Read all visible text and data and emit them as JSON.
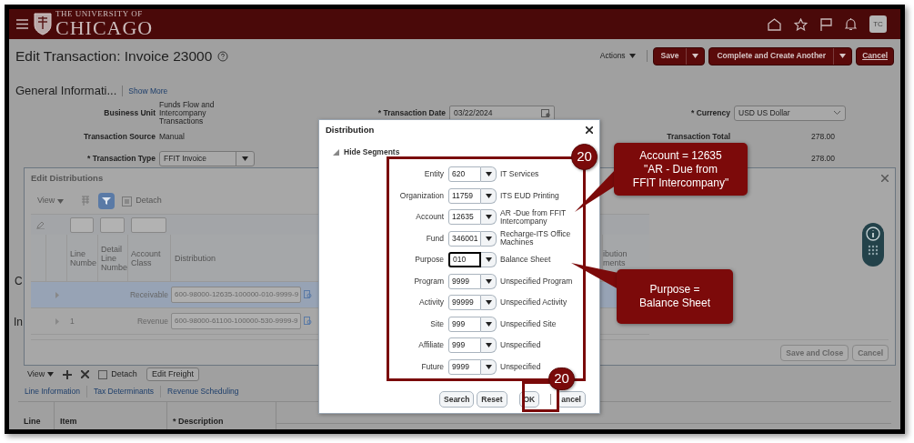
{
  "header": {
    "logo_top": "THE UNIVERSITY OF",
    "logo_bottom": "CHICAGO",
    "avatar": "TC"
  },
  "page": {
    "title": "Edit Transaction: Invoice 23000",
    "actions": "Actions",
    "buttons": [
      {
        "label": "Save",
        "kind": "split"
      },
      {
        "label": "Complete and Create Another",
        "kind": "split"
      },
      {
        "label": "Cancel",
        "kind": "plain"
      }
    ]
  },
  "general_information": {
    "title": "General Informati...",
    "show_more": "Show More",
    "columns": [
      [
        {
          "label": "Business Unit",
          "kind": "text",
          "value": "Funds Flow and Intercompany Transactions"
        },
        {
          "label": "Transaction Source",
          "kind": "text",
          "value": "Manual"
        },
        {
          "label": "* Transaction Type",
          "kind": "select",
          "value": "FFIT Invoice"
        }
      ],
      [
        {
          "label": "* Transaction Date",
          "kind": "date",
          "value": "03/22/2024"
        }
      ],
      [
        {
          "label": "* Currency",
          "kind": "select",
          "value": "USD US Dollar"
        },
        {
          "label": "Transaction Total",
          "kind": "text",
          "value": "278.00"
        },
        {
          "kind": "text",
          "value": "278.00"
        }
      ]
    ]
  },
  "covered_fragments": [
    "C",
    "In"
  ],
  "lines": {
    "toolbar": {
      "view": "View",
      "detach": "Detach",
      "edit_freight": "Edit Freight"
    },
    "tabs": [
      "Line Information",
      "Tax Determinants",
      "Revenue Scheduling"
    ],
    "columns": [
      "Line",
      "Item",
      "* Description"
    ]
  },
  "edit_distributions": {
    "title": "Edit Distributions",
    "toolbar": {
      "view": "View",
      "detach": "Detach"
    },
    "columns": [
      "Line Numbe",
      "Detail Line Numbe",
      "Account Class",
      "Distribution"
    ],
    "covered_column": "ibution ments",
    "rows": [
      {
        "account_class": "Receivable",
        "distribution": "600-98000-12635-100000-010-9999-9",
        "selected": true
      },
      {
        "line_number": "1",
        "account_class": "Revenue",
        "distribution": "600-98000-61100-100000-530-9999-9",
        "selected": false
      }
    ],
    "buttons": [
      "Save and Close",
      "Cancel"
    ]
  },
  "distribution": {
    "title": "Distribution",
    "segments_toggle": "Hide Segments",
    "segments": [
      {
        "label": "Entity",
        "value": "620",
        "description": "IT Services",
        "focused": false
      },
      {
        "label": "Organization",
        "value": "11759",
        "description": "ITS EUD Printing",
        "focused": false
      },
      {
        "label": "Account",
        "value": "12635",
        "description": "AR -Due from FFIT Intercompany",
        "focused": false
      },
      {
        "label": "Fund",
        "value": "346001",
        "description": "Recharge-ITS Office Machines",
        "focused": false
      },
      {
        "label": "Purpose",
        "value": "010",
        "description": "Balance Sheet",
        "focused": true
      },
      {
        "label": "Program",
        "value": "9999",
        "description": "Unspecified Program",
        "focused": false
      },
      {
        "label": "Activity",
        "value": "99999",
        "description": "Unspecified Activity",
        "focused": false
      },
      {
        "label": "Site",
        "value": "999",
        "description": "Unspecified Site",
        "focused": false
      },
      {
        "label": "Affiliate",
        "value": "999",
        "description": "Unspecified",
        "focused": false
      },
      {
        "label": "Future",
        "value": "9999",
        "description": "Unspecified",
        "focused": false
      }
    ],
    "buttons": [
      "Search",
      "Reset",
      "OK",
      "ancel"
    ]
  },
  "annotations": {
    "badges": [
      "20",
      "20"
    ],
    "callouts": [
      "Account = 12635\n\"AR - Due from\nFFIT Intercompany\"",
      "Purpose =\nBalance Sheet"
    ]
  }
}
